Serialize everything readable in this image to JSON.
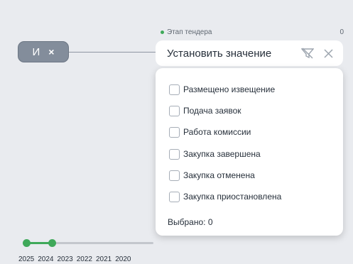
{
  "logic_pill": {
    "label": "И",
    "remove": "×"
  },
  "stage": {
    "label": "Этап тендера",
    "count": "0"
  },
  "value_input": {
    "text": "Установить значение"
  },
  "options": [
    {
      "label": "Размещено извещение",
      "checked": false
    },
    {
      "label": "Подача заявок",
      "checked": false
    },
    {
      "label": "Работа комиссии",
      "checked": false
    },
    {
      "label": "Закупка завершена",
      "checked": false
    },
    {
      "label": "Закупка отменена",
      "checked": false
    },
    {
      "label": "Закупка приостановлена",
      "checked": false
    }
  ],
  "selected": {
    "text": "Выбрано: 0"
  },
  "year_slider": {
    "years": [
      "2025",
      "2024",
      "2023",
      "2022",
      "2021",
      "2020"
    ],
    "selected_range": [
      "2025",
      "2024"
    ]
  },
  "colors": {
    "accent": "#3fa95a",
    "pill": "#838d9b",
    "background": "#e9ebef"
  }
}
